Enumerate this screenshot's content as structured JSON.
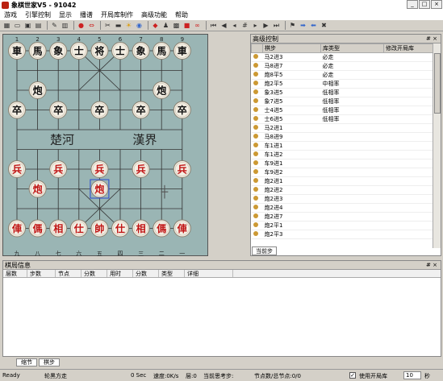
{
  "window": {
    "title": "象棋世家V5 - 91042",
    "minimize": "_",
    "maximize": "□",
    "close": "×"
  },
  "menu": [
    "游戏",
    "引擎控制",
    "显示",
    "播谱",
    "开局库制作",
    "高级功能",
    "帮助"
  ],
  "toolbar": {
    "icons": [
      "new-icon",
      "open-icon",
      "save-icon",
      "save-as-icon",
      "edit-icon",
      "grid-icon",
      "red-piece-icon",
      "flip-icon",
      "scissors-icon",
      "book-icon",
      "hint-icon",
      "web-icon",
      "engine-icon",
      "ladder-icon",
      "record-icon",
      "infinity-icon"
    ],
    "nav": [
      "first-icon",
      "prev-prev-icon",
      "prev-icon",
      "jump-icon",
      "next-icon",
      "next-next-icon",
      "last-icon",
      "flag-icon",
      "forward-icon",
      "back-icon",
      "stop-icon"
    ]
  },
  "board": {
    "river_left": "楚河",
    "river_right": "漢界",
    "col_labels_top": [
      "1",
      "2",
      "3",
      "4",
      "5",
      "6",
      "7",
      "8",
      "9"
    ],
    "col_labels_bottom": [
      "九",
      "八",
      "七",
      "六",
      "五",
      "四",
      "三",
      "二",
      "一"
    ],
    "pieces": [
      {
        "t": "車",
        "c": "black",
        "col": 0,
        "row": 0
      },
      {
        "t": "馬",
        "c": "black",
        "col": 1,
        "row": 0
      },
      {
        "t": "象",
        "c": "black",
        "col": 2,
        "row": 0
      },
      {
        "t": "士",
        "c": "black",
        "col": 3,
        "row": 0
      },
      {
        "t": "将",
        "c": "black",
        "col": 4,
        "row": 0
      },
      {
        "t": "士",
        "c": "black",
        "col": 5,
        "row": 0
      },
      {
        "t": "象",
        "c": "black",
        "col": 6,
        "row": 0
      },
      {
        "t": "馬",
        "c": "black",
        "col": 7,
        "row": 0
      },
      {
        "t": "車",
        "c": "black",
        "col": 8,
        "row": 0
      },
      {
        "t": "炮",
        "c": "black",
        "col": 1,
        "row": 2
      },
      {
        "t": "炮",
        "c": "black",
        "col": 7,
        "row": 2
      },
      {
        "t": "卒",
        "c": "black",
        "col": 0,
        "row": 3
      },
      {
        "t": "卒",
        "c": "black",
        "col": 2,
        "row": 3
      },
      {
        "t": "卒",
        "c": "black",
        "col": 4,
        "row": 3
      },
      {
        "t": "卒",
        "c": "black",
        "col": 6,
        "row": 3
      },
      {
        "t": "卒",
        "c": "black",
        "col": 8,
        "row": 3
      },
      {
        "t": "兵",
        "c": "red",
        "col": 0,
        "row": 6
      },
      {
        "t": "兵",
        "c": "red",
        "col": 2,
        "row": 6
      },
      {
        "t": "兵",
        "c": "red",
        "col": 4,
        "row": 6
      },
      {
        "t": "兵",
        "c": "red",
        "col": 6,
        "row": 6
      },
      {
        "t": "兵",
        "c": "red",
        "col": 8,
        "row": 6
      },
      {
        "t": "炮",
        "c": "red",
        "col": 1,
        "row": 7
      },
      {
        "t": "炮",
        "c": "red",
        "col": 4,
        "row": 7
      },
      {
        "t": "俥",
        "c": "red",
        "col": 0,
        "row": 9
      },
      {
        "t": "傌",
        "c": "red",
        "col": 1,
        "row": 9
      },
      {
        "t": "相",
        "c": "red",
        "col": 2,
        "row": 9
      },
      {
        "t": "仕",
        "c": "red",
        "col": 3,
        "row": 9
      },
      {
        "t": "帥",
        "c": "red",
        "col": 4,
        "row": 9
      },
      {
        "t": "仕",
        "c": "red",
        "col": 5,
        "row": 9
      },
      {
        "t": "相",
        "c": "red",
        "col": 6,
        "row": 9
      },
      {
        "t": "傌",
        "c": "red",
        "col": 7,
        "row": 9
      },
      {
        "t": "俥",
        "c": "red",
        "col": 8,
        "row": 9
      }
    ],
    "selected": {
      "col": 4,
      "row": 7
    }
  },
  "right_panel": {
    "title": "高级控制",
    "pin": "# ×",
    "columns": [
      "",
      "棋步",
      "库类型",
      "修改开局库"
    ],
    "rows": [
      [
        "马2进3",
        "必走"
      ],
      [
        "马8进7",
        "必走"
      ],
      [
        "炮8平5",
        "必走"
      ],
      [
        "炮2平5",
        "中相率"
      ],
      [
        "象3进5",
        "低相率"
      ],
      [
        "象7进5",
        "低相率"
      ],
      [
        "士4进5",
        "低相率"
      ],
      [
        "士6进5",
        "低相率"
      ],
      [
        "马2进1",
        ""
      ],
      [
        "马8进9",
        ""
      ],
      [
        "车1进1",
        ""
      ],
      [
        "车1进2",
        ""
      ],
      [
        "车9进1",
        ""
      ],
      [
        "车9进2",
        ""
      ],
      [
        "炮2进1",
        ""
      ],
      [
        "炮2进2",
        ""
      ],
      [
        "炮2进3",
        ""
      ],
      [
        "炮2进4",
        ""
      ],
      [
        "炮2进7",
        ""
      ],
      [
        "炮2平1",
        ""
      ],
      [
        "炮2平3",
        ""
      ]
    ],
    "tab": "当前步"
  },
  "lower_panel": {
    "title": "棋局信息",
    "pin": "# ×",
    "columns": [
      "层数",
      "步数",
      "节点",
      "分数",
      "用时",
      "分数",
      "类型",
      "详细"
    ],
    "tabs": [
      "缩节",
      "棋步"
    ]
  },
  "status": {
    "ready": "Ready",
    "mode": "轮黑方走",
    "time": "0 Sec",
    "speed": "速度:0K/s",
    "depth": "层:0",
    "thinking": "当前思考步:",
    "nodes": "节点数/总节点:0/0",
    "use_book": "使用开局库",
    "seconds_value": "10",
    "seconds_unit": "秒"
  }
}
